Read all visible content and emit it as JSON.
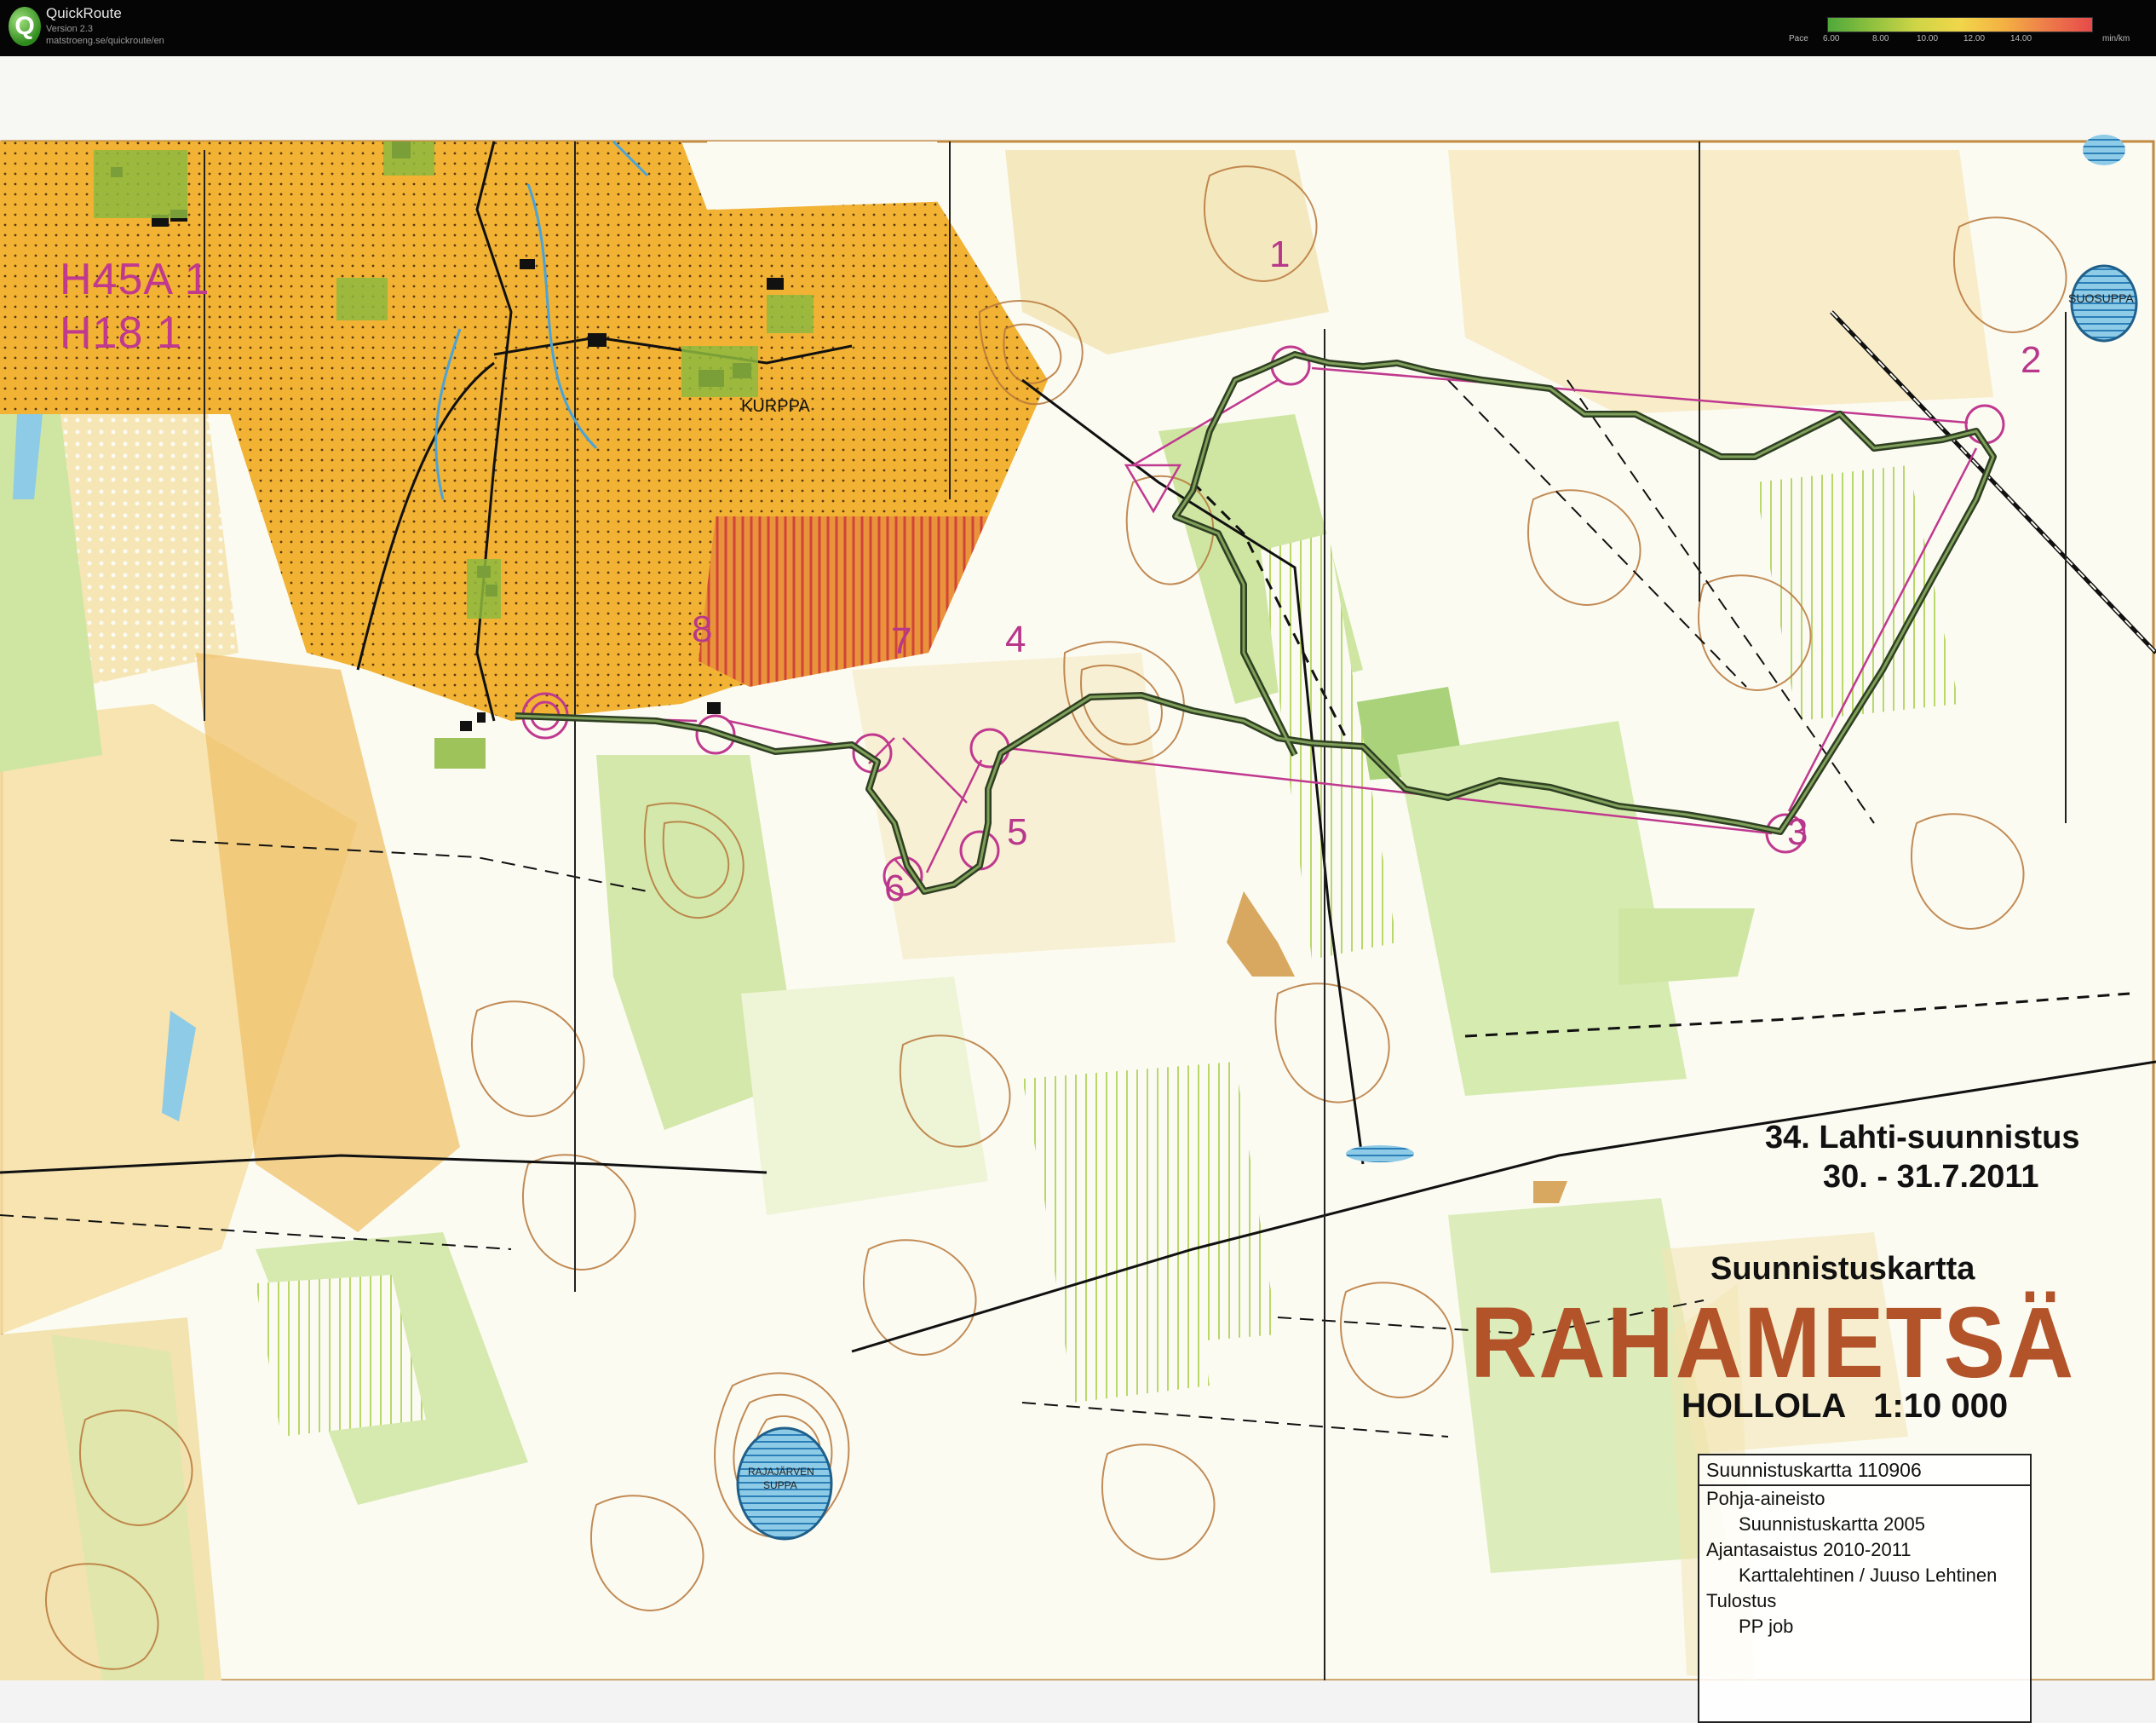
{
  "app": {
    "title": "QuickRoute",
    "version": "Version 2.3",
    "url": "matstroeng.se/quickroute/en",
    "logo_letter": "Q"
  },
  "pace_legend": {
    "label": "Pace",
    "ticks": [
      "6.00",
      "8.00",
      "10.00",
      "12.00",
      "14.00"
    ],
    "unit": "min/km",
    "gradient_colors": [
      "#4fa83a",
      "#8fc13f",
      "#cfd546",
      "#f1d64a",
      "#f3b143",
      "#ee7a4a",
      "#e64a4a"
    ]
  },
  "map": {
    "class_lines": [
      "H45A 1",
      "H18 1"
    ],
    "places": {
      "farm": "KURPPA",
      "pit": "SUOSUPPA",
      "lake_line1": "RAJAJÄRVEN",
      "lake_line2": "SUPPA"
    },
    "controls": [
      "1",
      "2",
      "3",
      "4",
      "5",
      "6",
      "7",
      "8"
    ],
    "event": {
      "title": "34. Lahti-suunnistus",
      "date": "30. - 31.7.2011",
      "map_kind": "Suunnistuskartta",
      "map_name": "RAHAMETSÄ",
      "place_scale": "HOLLOLA   1:10 000"
    },
    "info": {
      "header": "Suunnistuskartta 110906",
      "base_label": "Pohja-aineisto",
      "base_value": "Suunnistuskartta 2005",
      "update_label": "Ajantasaistus 2010-2011",
      "update_value": "Karttalehtinen / Juuso Lehtinen",
      "print_label": "Tulostus",
      "print_value": "PP job"
    },
    "colors": {
      "open_land": "#f2b233",
      "light_green": "#cfe6a3",
      "course": "#c0398f",
      "route": "#3d5a2e",
      "contour": "#b7773a"
    }
  }
}
